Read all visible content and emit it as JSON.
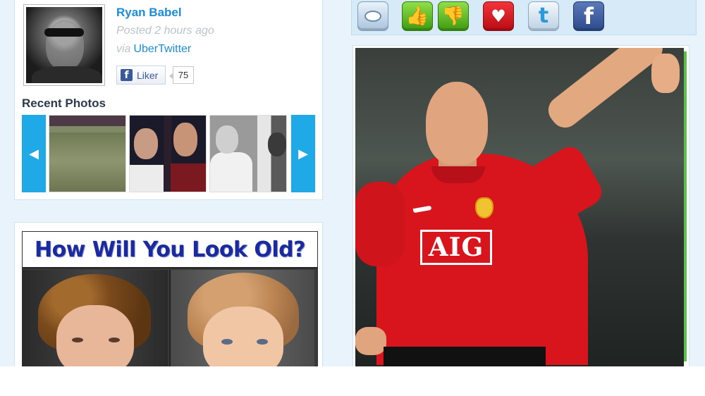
{
  "profile": {
    "name": "Ryan Babel",
    "posted": "Posted 2 hours ago",
    "via_word": "via",
    "via_app": "UberTwitter",
    "like_label": "Liker",
    "like_count": "75",
    "fb_letter": "f"
  },
  "recent_photos": {
    "title": "Recent Photos",
    "prev_arrow": "◀",
    "next_arrow": "▶",
    "thumbnails": [
      "thumbnail-pitch",
      "thumbnail-players",
      "thumbnail-friends"
    ]
  },
  "ad": {
    "headline": "How Will You Look Old?"
  },
  "share_bar": {
    "buttons": [
      {
        "name": "comment-icon"
      },
      {
        "name": "thumbs-up-icon",
        "glyph": "👍"
      },
      {
        "name": "thumbs-down-icon",
        "glyph": "👎"
      },
      {
        "name": "heart-icon",
        "glyph": "♥"
      },
      {
        "name": "twitter-icon",
        "glyph": "t"
      },
      {
        "name": "facebook-icon",
        "glyph": "f"
      }
    ]
  },
  "main_photo": {
    "sponsor_text": "AIG"
  },
  "colors": {
    "link_blue": "#1e8bd6",
    "accent_cyan": "#1fa9e6",
    "page_bg": "#e9f3fb",
    "facebook_blue": "#3b5998",
    "kit_red": "#d8141c"
  }
}
